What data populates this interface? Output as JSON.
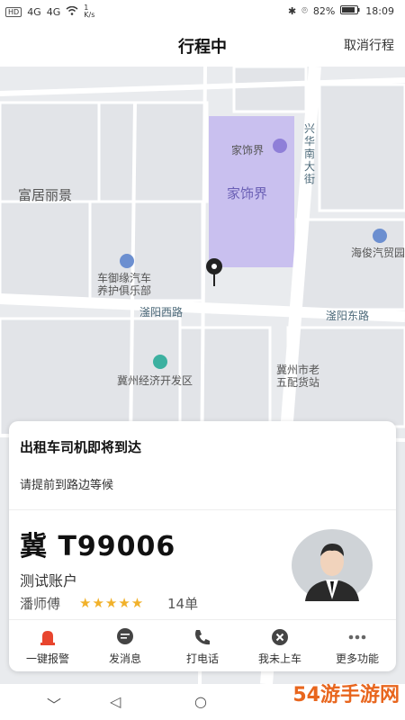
{
  "status": {
    "left_badges": [
      "HD",
      "HD"
    ],
    "signal1": "4G",
    "signal2": "4G",
    "speed": "1\nK/s",
    "battery": "82%",
    "time": "18:09"
  },
  "header": {
    "title": "行程中",
    "cancel_label": "取消行程"
  },
  "map": {
    "labels": {
      "fuju": "富居丽景",
      "jiashijie_top": "家饰界",
      "jiashijie_block": "家饰界",
      "xinghua": "兴华南大街",
      "haijun": "海俊汽贸园",
      "cheyu": "车御缘汽车",
      "cheyu2": "养护俱乐部",
      "fuyang_w": "滏阳西路",
      "fuyang_e": "滏阳东路",
      "jizhou_dev": "冀州经济开发区",
      "jizhou_shop1": "冀州市老",
      "jizhou_shop2": "五配货站"
    }
  },
  "card": {
    "heading": "出租车司机即将到达",
    "subheading": "请提前到路边等候",
    "plate": "冀 T99006",
    "account": "测试账户",
    "driver": "潘师傅",
    "rating_stars": "★★★★★",
    "orders": "14单",
    "actions": [
      {
        "label": "一键报警",
        "icon": "alarm-icon",
        "color": "#e8452e"
      },
      {
        "label": "发消息",
        "icon": "message-icon",
        "color": "#444444"
      },
      {
        "label": "打电话",
        "icon": "phone-icon",
        "color": "#444444"
      },
      {
        "label": "我未上车",
        "icon": "close-circle-icon",
        "color": "#444444"
      },
      {
        "label": "更多功能",
        "icon": "more-icon",
        "color": "#666666"
      }
    ]
  },
  "navbar": {
    "back": "◁",
    "home": "○",
    "menu": "﹀"
  },
  "watermark": "54游手游网"
}
